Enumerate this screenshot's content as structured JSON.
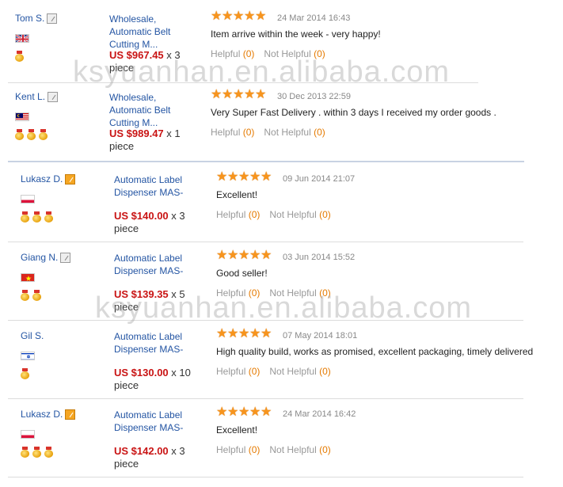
{
  "watermark": "ksyuanhan.en.alibaba.com",
  "reviews": [
    {
      "name": "Tom S.",
      "product": "Wholesale, Automatic Belt Cutting M...",
      "price": "US $967.45",
      "qty": " x 3 piece",
      "date": "24 Mar 2014 16:43",
      "comment": "Item arrive within the week - very happy!",
      "helpful_label": "Helpful",
      "helpful_count": "(0)",
      "not_helpful_label": "Not Helpful",
      "not_helpful_count": "(0)",
      "flag": "uk-flag-icon",
      "medals": 1
    },
    {
      "name": "Kent L.",
      "product": "Wholesale, Automatic Belt Cutting M...",
      "price": "US $989.47",
      "qty": " x 1 piece",
      "date": "30 Dec 2013 22:59",
      "comment": "Very Super Fast Delivery . within 3 days I received my order goods .",
      "helpful_label": "Helpful",
      "helpful_count": "(0)",
      "not_helpful_label": "Not Helpful",
      "not_helpful_count": "(0)",
      "flag": "malaysia-flag-icon",
      "medals": 3
    },
    {
      "name": "Lukasz D.",
      "product": "Automatic Label Dispenser MAS-",
      "price": "US $140.00",
      "qty": " x 3 piece",
      "date": "09 Jun 2014 21:07",
      "comment": "Excellent!",
      "helpful_label": "Helpful",
      "helpful_count": "(0)",
      "not_helpful_label": "Not Helpful",
      "not_helpful_count": "(0)",
      "flag": "poland-flag-icon",
      "medals": 3
    },
    {
      "name": "Giang N.",
      "product": "Automatic Label Dispenser MAS-",
      "price": "US $139.35",
      "qty": " x 5 piece",
      "date": "03 Jun 2014 15:52",
      "comment": "Good seller!",
      "helpful_label": "Helpful",
      "helpful_count": "(0)",
      "not_helpful_label": "Not Helpful",
      "not_helpful_count": "(0)",
      "flag": "vietnam-flag-icon",
      "medals": 2
    },
    {
      "name": "Gil S.",
      "product": "Automatic Label Dispenser MAS-",
      "price": "US $130.00",
      "qty": " x 10 piece",
      "date": "07 May 2014 18:01",
      "comment": "High quality build, works as promised, excellent packaging, timely delivered",
      "helpful_label": "Helpful",
      "helpful_count": "(0)",
      "not_helpful_label": "Not Helpful",
      "not_helpful_count": "(0)",
      "flag": "israel-flag-icon",
      "medals": 1
    },
    {
      "name": "Lukasz D.",
      "product": "Automatic Label Dispenser MAS-",
      "price": "US $142.00",
      "qty": " x 3 piece",
      "date": "24 Mar 2014 16:42",
      "comment": "Excellent!",
      "helpful_label": "Helpful",
      "helpful_count": "(0)",
      "not_helpful_label": "Not Helpful",
      "not_helpful_count": "(0)",
      "flag": "poland-flag-icon",
      "medals": 3
    }
  ],
  "colors": {
    "price": "#c91414",
    "link": "#2455a3",
    "star": "#f7941d",
    "count": "#e57a00"
  }
}
